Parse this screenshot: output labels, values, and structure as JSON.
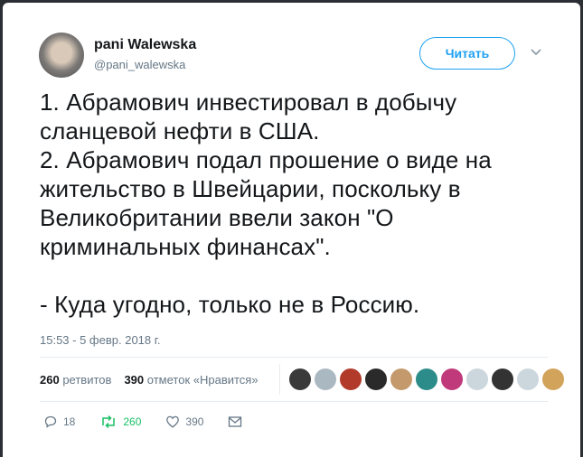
{
  "author": {
    "name": "pani Walewska",
    "handle": "@pani_walewska"
  },
  "follow_button": {
    "label": "Читать"
  },
  "tweet": {
    "text": "1. Абрамович инвестировал в добычу\nсланцевой нефти в США.\n2. Абрамович подал прошение о виде на\nжительство в Швейцарии, поскольку в\nВеликобритании ввели закон \"О\nкриминальных финансах\".\n\n- Куда угодно, только не в Россию.",
    "timestamp": "15:53 - 5 февр. 2018 г."
  },
  "stats": {
    "retweets_count": "260",
    "retweets_label": "ретвитов",
    "likes_count": "390",
    "likes_label": "отметок «Нравится»"
  },
  "liker_avatars": [
    {
      "icon": "avatar-senor-developer",
      "color": "#3a3a3a"
    },
    {
      "icon": "avatar-egg",
      "color": "#aab8c2"
    },
    {
      "icon": "avatar-red",
      "color": "#b23a2a"
    },
    {
      "icon": "avatar-dark",
      "color": "#2a2a2a"
    },
    {
      "icon": "avatar-face",
      "color": "#c49a6c"
    },
    {
      "icon": "avatar-teal",
      "color": "#2c8c8a"
    },
    {
      "icon": "avatar-pink",
      "color": "#c0397a"
    },
    {
      "icon": "avatar-default",
      "color": "#ccd6dd"
    },
    {
      "icon": "avatar-photo",
      "color": "#333333"
    },
    {
      "icon": "avatar-default-2",
      "color": "#ccd6dd"
    },
    {
      "icon": "avatar-tiger",
      "color": "#d2a35a"
    }
  ],
  "actions": {
    "reply_count": "18",
    "retweet_count": "260",
    "like_count": "390"
  },
  "colors": {
    "accent": "#1da1f2",
    "retweet": "#17bf63",
    "muted": "#657786",
    "text": "#14171a"
  }
}
